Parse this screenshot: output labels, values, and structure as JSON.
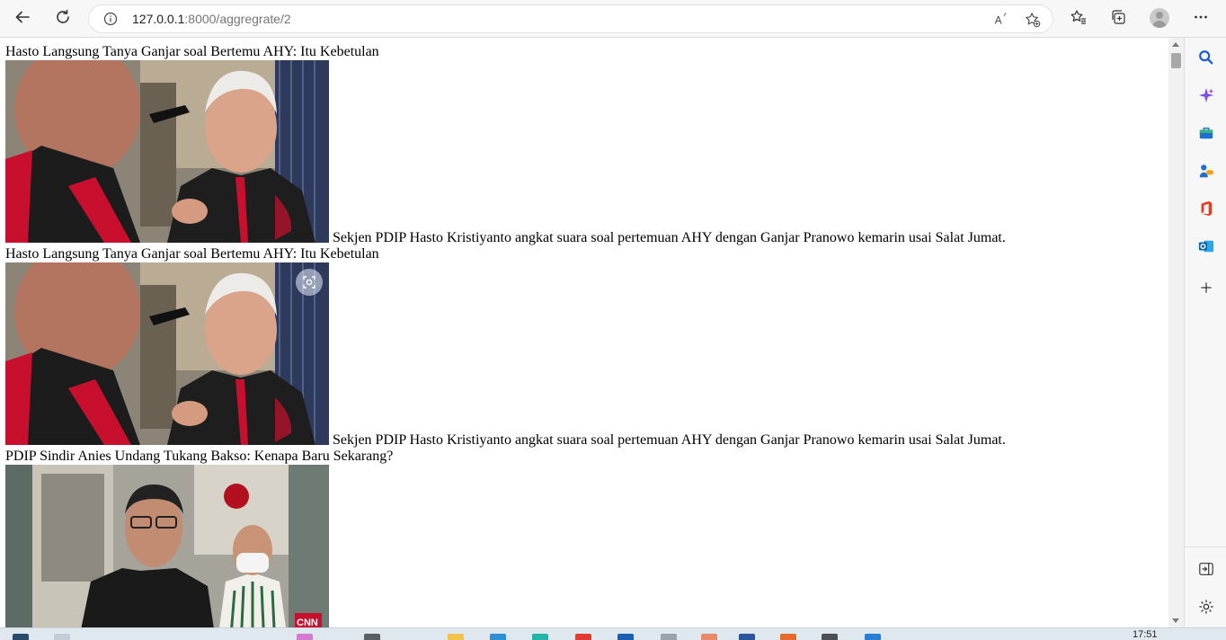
{
  "browser": {
    "url_host": "127.0.0.1",
    "url_path": ":8000/aggregrate/2",
    "icons": [
      "back-icon",
      "refresh-icon",
      "info-icon",
      "read-aloud-icon",
      "add-favorite-icon",
      "favorites-icon",
      "collections-icon",
      "profile-avatar",
      "more-icon"
    ]
  },
  "articles": [
    {
      "title": "Hasto Langsung Tanya Ganjar soal Bertemu AHY: Itu Kebetulan",
      "description": "Sekjen PDIP Hasto Kristiyanto angkat suara soal pertemuan AHY dengan Ganjar Pranowo kemarin usai Salat Jumat."
    },
    {
      "title": "Hasto Langsung Tanya Ganjar soal Bertemu AHY: Itu Kebetulan",
      "description": "Sekjen PDIP Hasto Kristiyanto angkat suara soal pertemuan AHY dengan Ganjar Pranowo kemarin usai Salat Jumat."
    },
    {
      "title": "PDIP Sindir Anies Undang Tukang Bakso: Kenapa Baru Sekarang?",
      "image_watermark": "CNN"
    }
  ],
  "sidebar": {
    "icons": [
      "search-icon",
      "copilot-icon",
      "shopping-icon",
      "games-icon",
      "office-icon",
      "outlook-icon",
      "add-icon",
      "hide-sidebar-icon",
      "settings-icon"
    ]
  },
  "taskbar": {
    "clock": "17:51"
  },
  "colors": {
    "toolbar_bg": "#f7f7f7",
    "page_bg": "#ffffff",
    "sidebar_bg": "#f7f7f7",
    "pdip_red": "#c8102e"
  }
}
